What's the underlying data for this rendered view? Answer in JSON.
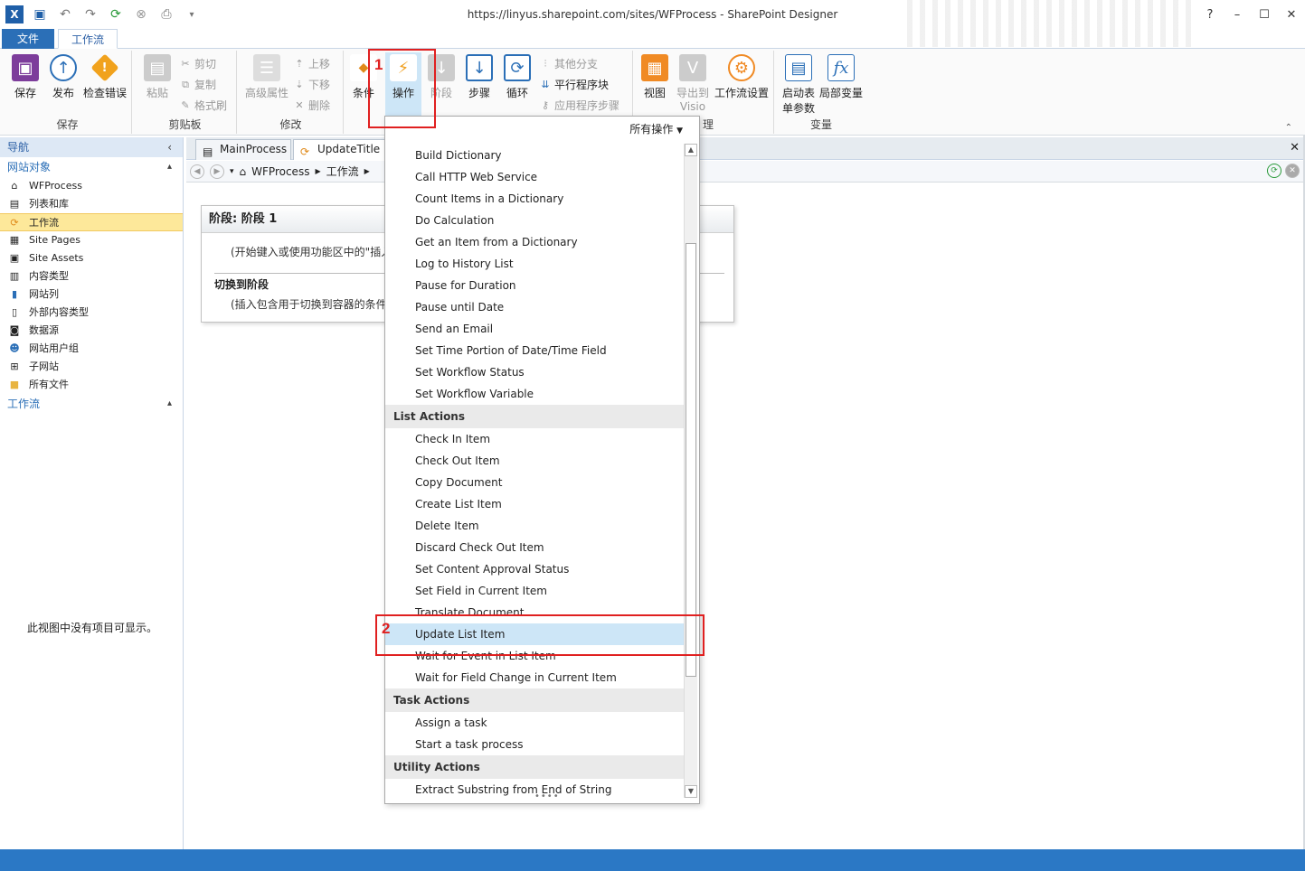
{
  "window": {
    "title": "https://linyus.sharepoint.com/sites/WFProcess - SharePoint Designer",
    "help": "?",
    "minimize": "–",
    "maximize": "☐",
    "close": "✕"
  },
  "ribbon_tabs": {
    "file": "文件",
    "workflow": "工作流"
  },
  "ribbon": {
    "save": {
      "save": "保存",
      "publish": "发布",
      "check_errors": "检查错误",
      "group": "保存"
    },
    "clipboard": {
      "paste": "粘贴",
      "cut": "剪切",
      "copy": "复制",
      "format_painter": "格式刷",
      "group": "剪贴板"
    },
    "modify": {
      "advanced_properties": "高级属性",
      "move_up": "上移",
      "move_down": "下移",
      "delete": "删除",
      "group": "修改"
    },
    "insert": {
      "condition": "条件",
      "action": "操作",
      "stage": "阶段",
      "step": "步骤",
      "loop": "循环",
      "else_branch": "其他分支",
      "parallel_block": "平行程序块",
      "app_step": "应用程序步骤"
    },
    "manage": {
      "views": "视图",
      "export_line1": "导出到",
      "export_line2": "Visio",
      "workflow_settings": "工作流设置",
      "group_partial": "理"
    },
    "variables": {
      "init_line1": "启动表",
      "init_line2": "单参数",
      "local_vars": "局部变量",
      "group": "变量"
    }
  },
  "nav": {
    "header": "导航",
    "site_objects": "网站对象",
    "items": [
      {
        "label": "WFProcess",
        "icon": "home-icon"
      },
      {
        "label": "列表和库",
        "icon": "list-icon"
      },
      {
        "label": "工作流",
        "icon": "workflow-icon"
      },
      {
        "label": "Site Pages",
        "icon": "page-icon"
      },
      {
        "label": "Site Assets",
        "icon": "assets-icon"
      },
      {
        "label": "内容类型",
        "icon": "content-type-icon"
      },
      {
        "label": "网站列",
        "icon": "column-icon"
      },
      {
        "label": "外部内容类型",
        "icon": "external-content-icon"
      },
      {
        "label": "数据源",
        "icon": "database-icon"
      },
      {
        "label": "网站用户组",
        "icon": "users-icon"
      },
      {
        "label": "子网站",
        "icon": "subsite-icon"
      },
      {
        "label": "所有文件",
        "icon": "folder-icon"
      }
    ],
    "workflows_section": "工作流",
    "empty_message": "此视图中没有项目可显示。"
  },
  "doc_tabs": [
    {
      "label": "MainProcess"
    },
    {
      "label": "UpdateTitle"
    }
  ],
  "breadcrumb": {
    "root": "WFProcess",
    "level1": "工作流"
  },
  "stage": {
    "title": "阶段: 阶段 1",
    "hint": "(开始键入或使用功能区中的\"插入\"组。)",
    "transition_label": "切换到阶段",
    "transition_hint": "(插入包含用于切换到容器的条件和操作。)"
  },
  "dropdown": {
    "filter": "所有操作",
    "core_items": [
      "Build Dictionary",
      "Call HTTP Web Service",
      "Count Items in a Dictionary",
      "Do Calculation",
      "Get an Item from a Dictionary",
      "Log to History List",
      "Pause for Duration",
      "Pause until Date",
      "Send an Email",
      "Set Time Portion of Date/Time Field",
      "Set Workflow Status",
      "Set Workflow Variable"
    ],
    "list_actions_header": "List Actions",
    "list_items": [
      "Check In Item",
      "Check Out Item",
      "Copy Document",
      "Create List Item",
      "Delete Item",
      "Discard Check Out Item",
      "Set Content Approval Status",
      "Set Field in Current Item",
      "Translate Document",
      "Update List Item",
      "Wait for Event in List Item",
      "Wait for Field Change in Current Item"
    ],
    "task_actions_header": "Task Actions",
    "task_items": [
      "Assign a task",
      "Start a task process"
    ],
    "utility_actions_header": "Utility Actions",
    "utility_items": [
      "Extract Substring from End of String"
    ]
  },
  "annotations": {
    "one": "1",
    "two": "2"
  },
  "colors": {
    "accent": "#2b6fb7",
    "annotation": "#e02020",
    "highlight": "#cde6f7",
    "selected_nav": "#fde89a"
  }
}
